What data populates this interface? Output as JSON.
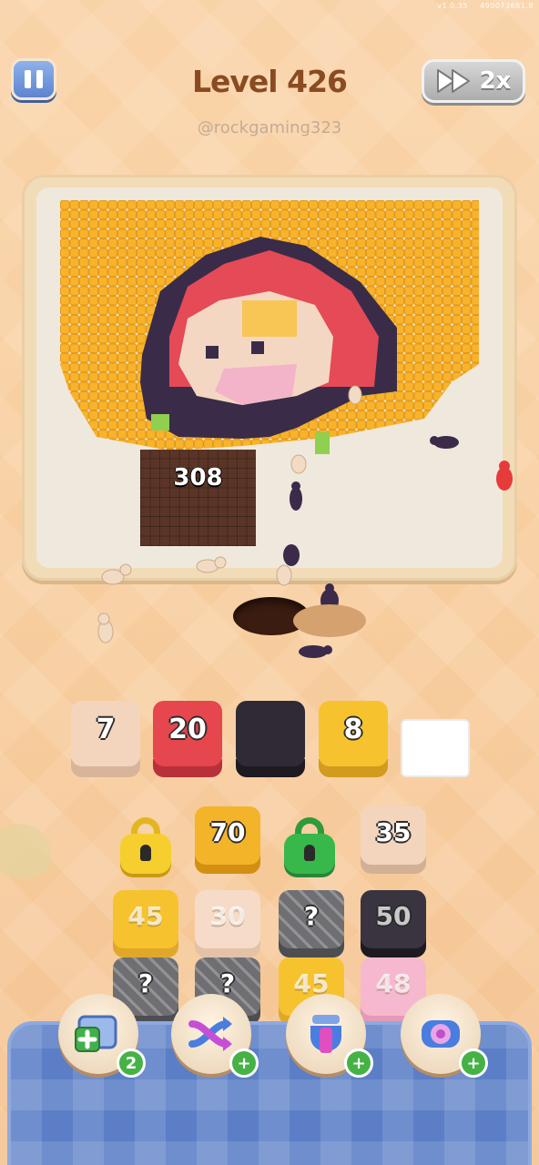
{
  "status": {
    "left_text": "v1.0.35",
    "right_text": "490073681.8"
  },
  "header": {
    "title": "Level 426",
    "username": "@rockgaming323",
    "speed_label": "2x"
  },
  "board": {
    "stamp_count": "308"
  },
  "queue": [
    {
      "value": "7",
      "color": "#f3d5be"
    },
    {
      "value": "20",
      "color": "#e6464d"
    },
    {
      "value": "",
      "color": "#2f2a36"
    },
    {
      "value": "8",
      "color": "#f6c32f"
    }
  ],
  "grid": {
    "row1": [
      {
        "value": "",
        "kind": "lock",
        "color": "#f6cf2f"
      },
      {
        "value": "70",
        "kind": "tile",
        "color": "#f4b42a"
      },
      {
        "value": "",
        "kind": "lock",
        "color": "#38b84a"
      },
      {
        "value": "35",
        "kind": "tile",
        "color": "#f3d5be"
      }
    ],
    "row2": [
      {
        "value": "45",
        "kind": "tile",
        "color": "#f6c32f"
      },
      {
        "value": "30",
        "kind": "tile",
        "color": "#f3d5be"
      },
      {
        "value": "?",
        "kind": "mystery",
        "color": "#6f6f73"
      },
      {
        "value": "50",
        "kind": "tile",
        "color": "#2f2a36"
      }
    ],
    "row3": [
      {
        "value": "?",
        "kind": "mystery",
        "color": "#6f6f73"
      },
      {
        "value": "?",
        "kind": "mystery",
        "color": "#6f6f73"
      },
      {
        "value": "45",
        "kind": "tile",
        "color": "#f6c32f"
      },
      {
        "value": "48",
        "kind": "tile",
        "color": "#f6b8cf"
      }
    ]
  },
  "boosters": [
    {
      "icon": "add-slot-icon",
      "count": "2"
    },
    {
      "icon": "shuffle-icon",
      "count": "+"
    },
    {
      "icon": "magnet-icon",
      "count": "+"
    },
    {
      "icon": "spray-icon",
      "count": "+"
    }
  ]
}
